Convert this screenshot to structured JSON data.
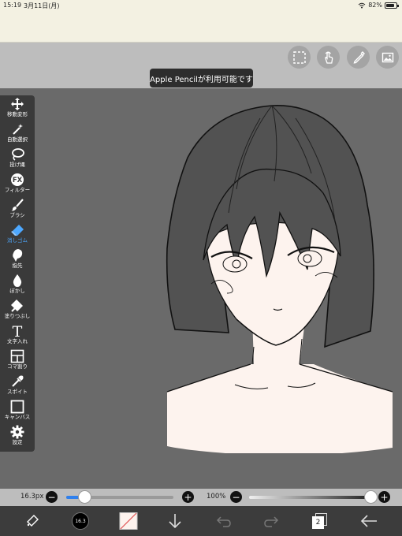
{
  "status": {
    "time": "15:19",
    "date": "3月11日(月)",
    "battery_pct": "82%",
    "battery_level": 0.82
  },
  "tooltip": "Apple Pencilが利用可能です",
  "tools": [
    {
      "label": "移動変形",
      "icon": "move-icon"
    },
    {
      "label": "自動選択",
      "icon": "magic-wand-icon"
    },
    {
      "label": "投げ縄",
      "icon": "lasso-icon"
    },
    {
      "label": "フィルター",
      "icon": "fx-icon"
    },
    {
      "label": "ブラシ",
      "icon": "brush-icon"
    },
    {
      "label": "消しゴム",
      "icon": "eraser-icon",
      "active": true
    },
    {
      "label": "指先",
      "icon": "finger-icon"
    },
    {
      "label": "ぼかし",
      "icon": "blur-drop-icon"
    },
    {
      "label": "塗りつぶし",
      "icon": "fill-icon"
    },
    {
      "label": "文字入れ",
      "icon": "text-icon"
    },
    {
      "label": "コマ割り",
      "icon": "frame-divide-icon"
    },
    {
      "label": "スポイト",
      "icon": "eyedropper-icon"
    },
    {
      "label": "キャンバス",
      "icon": "canvas-icon"
    },
    {
      "label": "設定",
      "icon": "gear-icon"
    }
  ],
  "brush": {
    "size_label": "16.3px",
    "size_level": 0.17,
    "opacity_label": "100%",
    "opacity_level": 1.0
  },
  "bottom": {
    "brush_size_badge": "16.3",
    "layer_count": "2"
  },
  "colors": {
    "accent": "#2f80ed",
    "active_tool": "#4da8ff",
    "skin": "#fdf3ee"
  }
}
